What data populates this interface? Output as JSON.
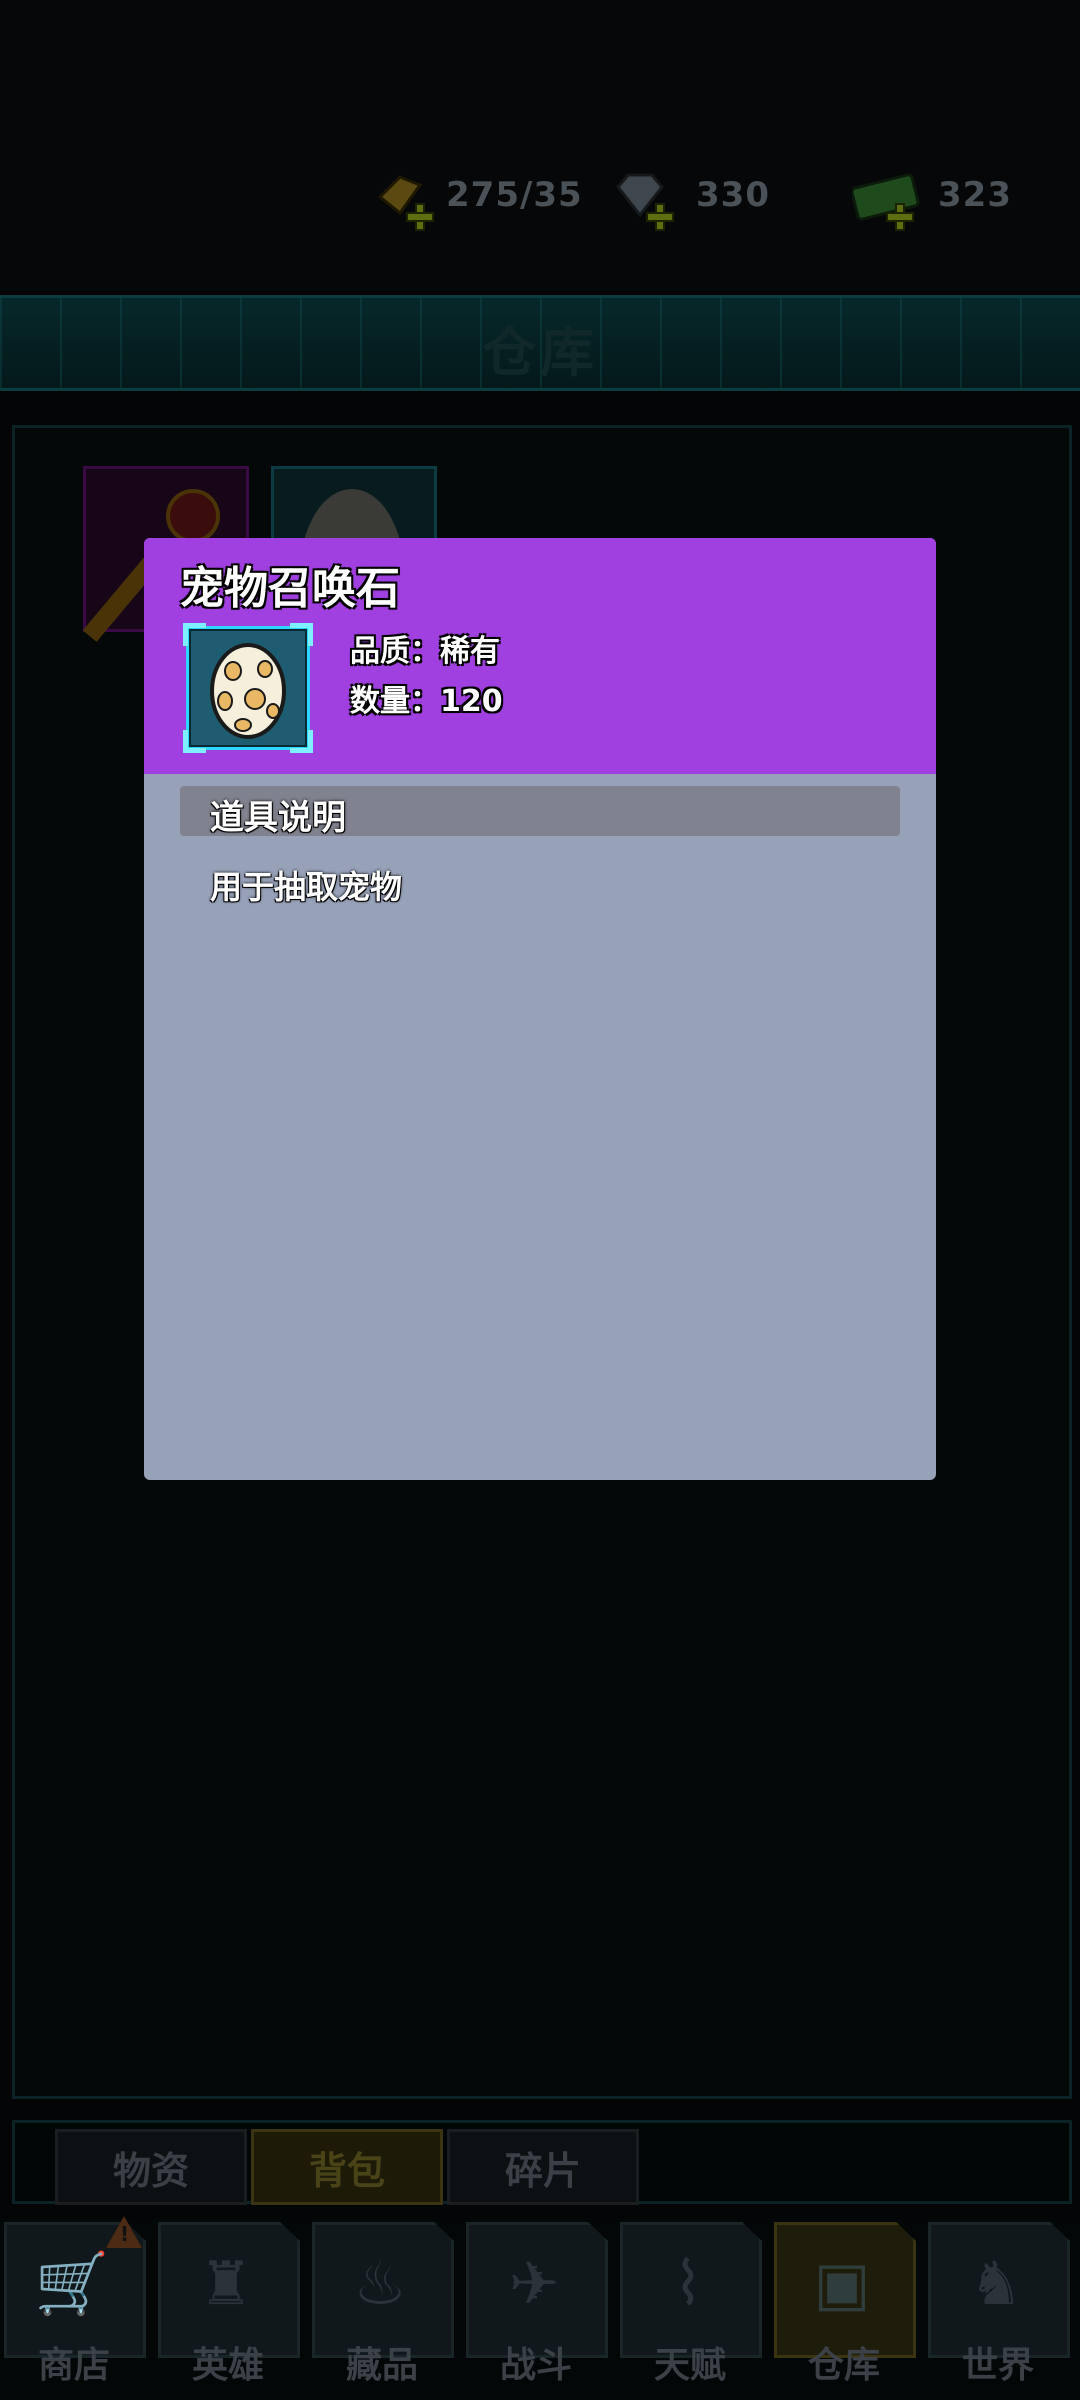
{
  "resources": [
    {
      "name": "stamina",
      "icon": "energy-icon",
      "value": "275/35"
    },
    {
      "name": "diamond",
      "icon": "diamond-icon",
      "value": "330"
    },
    {
      "name": "cash",
      "icon": "cash-icon",
      "value": "323"
    }
  ],
  "header": {
    "title": "仓库"
  },
  "subtabs": [
    "物资",
    "背包",
    "碎片"
  ],
  "subtab_active": "背包",
  "nav": [
    {
      "label": "商店",
      "icon": "cart-icon"
    },
    {
      "label": "英雄",
      "icon": "hero-icon"
    },
    {
      "label": "藏品",
      "icon": "flame-icon"
    },
    {
      "label": "战斗",
      "icon": "rifle-icon"
    },
    {
      "label": "天赋",
      "icon": "dna-icon"
    },
    {
      "label": "仓库",
      "icon": "box-icon"
    },
    {
      "label": "世界",
      "icon": "demon-icon"
    }
  ],
  "nav_active": "仓库",
  "item_popup": {
    "name": "宠物召唤石",
    "quality_label": "品质：稀有",
    "quantity_label": "数量：120",
    "section_title": "道具说明",
    "description": "用于抽取宠物",
    "header_color": "#a140e0"
  }
}
